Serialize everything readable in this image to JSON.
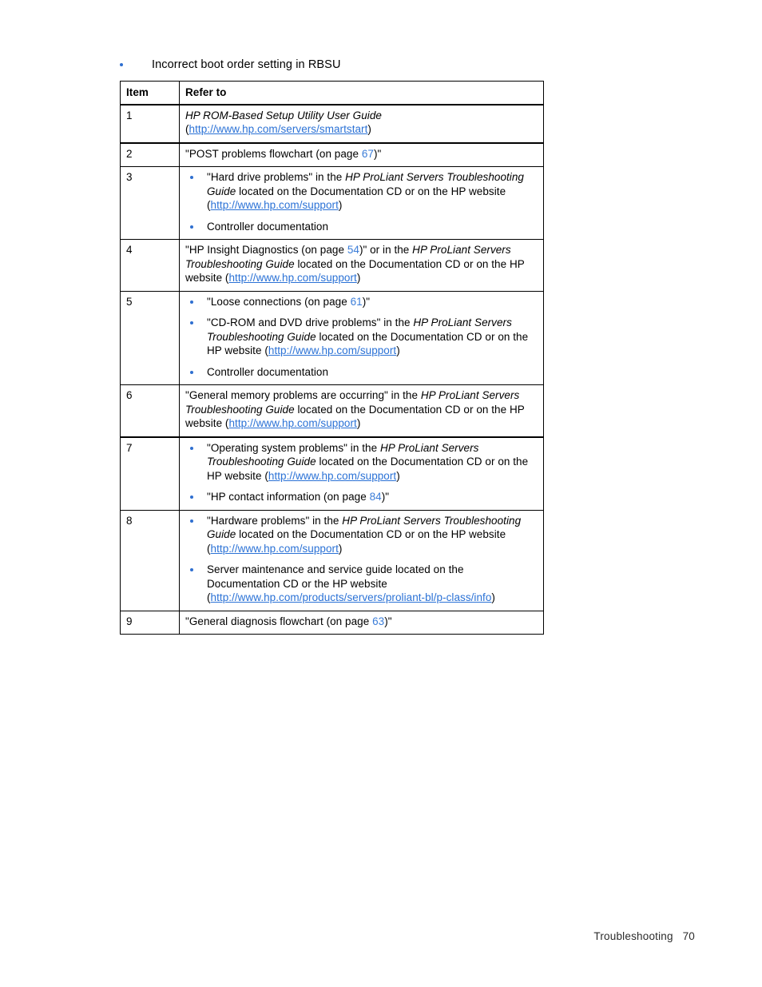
{
  "document": {
    "intro_bullet": "Incorrect boot order setting in RBSU",
    "table": {
      "headers": {
        "item": "Item",
        "refer_to": "Refer to"
      },
      "rows": [
        {
          "item": "1",
          "blocks": [
            {
              "type": "paragraph",
              "segments": [
                {
                  "kind": "italic",
                  "text": "HP ROM-Based Setup Utility User Guide"
                },
                {
                  "kind": "break",
                  "text": ""
                },
                {
                  "kind": "text",
                  "text": "("
                },
                {
                  "kind": "link",
                  "text": "http://www.hp.com/servers/smartstart"
                },
                {
                  "kind": "text",
                  "text": ")"
                }
              ]
            }
          ]
        },
        {
          "item": "2",
          "blocks": [
            {
              "type": "paragraph",
              "segments": [
                {
                  "kind": "text",
                  "text": "\"POST problems flowchart (on page "
                },
                {
                  "kind": "page",
                  "text": "67"
                },
                {
                  "kind": "text",
                  "text": ")\""
                }
              ]
            }
          ]
        },
        {
          "item": "3",
          "blocks": [
            {
              "type": "bullet",
              "segments": [
                {
                  "kind": "text",
                  "text": "\"Hard drive problems\" in the "
                },
                {
                  "kind": "italic",
                  "text": "HP ProLiant Servers Troubleshooting Guide"
                },
                {
                  "kind": "text",
                  "text": " located on the Documentation CD or on the HP website ("
                },
                {
                  "kind": "link",
                  "text": "http://www.hp.com/support"
                },
                {
                  "kind": "text",
                  "text": ")"
                }
              ]
            },
            {
              "type": "bullet",
              "segments": [
                {
                  "kind": "text",
                  "text": "Controller documentation"
                }
              ]
            }
          ]
        },
        {
          "item": "4",
          "blocks": [
            {
              "type": "paragraph",
              "segments": [
                {
                  "kind": "text",
                  "text": "\"HP Insight Diagnostics (on page "
                },
                {
                  "kind": "page",
                  "text": "54"
                },
                {
                  "kind": "text",
                  "text": ")\" or in the "
                },
                {
                  "kind": "italic",
                  "text": "HP ProLiant Servers Troubleshooting Guide"
                },
                {
                  "kind": "text",
                  "text": " located on the Documentation CD or on the HP website ("
                },
                {
                  "kind": "link",
                  "text": "http://www.hp.com/support"
                },
                {
                  "kind": "text",
                  "text": ")"
                }
              ]
            }
          ]
        },
        {
          "item": "5",
          "blocks": [
            {
              "type": "bullet",
              "segments": [
                {
                  "kind": "text",
                  "text": "\"Loose connections (on page "
                },
                {
                  "kind": "page",
                  "text": "61"
                },
                {
                  "kind": "text",
                  "text": ")\""
                }
              ]
            },
            {
              "type": "bullet",
              "segments": [
                {
                  "kind": "text",
                  "text": "\"CD-ROM and DVD drive problems\" in the "
                },
                {
                  "kind": "italic",
                  "text": "HP ProLiant Servers Troubleshooting Guide"
                },
                {
                  "kind": "text",
                  "text": " located on the Documentation CD or on the HP website ("
                },
                {
                  "kind": "link",
                  "text": "http://www.hp.com/support"
                },
                {
                  "kind": "text",
                  "text": ")"
                }
              ]
            },
            {
              "type": "bullet",
              "segments": [
                {
                  "kind": "text",
                  "text": "Controller documentation"
                }
              ]
            }
          ]
        },
        {
          "item": "6",
          "blocks": [
            {
              "type": "paragraph",
              "segments": [
                {
                  "kind": "text",
                  "text": "\"General memory problems are occurring\" in the "
                },
                {
                  "kind": "italic",
                  "text": "HP ProLiant Servers Troubleshooting Guide"
                },
                {
                  "kind": "text",
                  "text": " located on the Documentation CD or on the HP website ("
                },
                {
                  "kind": "link",
                  "text": "http://www.hp.com/support"
                },
                {
                  "kind": "text",
                  "text": ")"
                }
              ]
            }
          ]
        },
        {
          "item": "7",
          "blocks": [
            {
              "type": "bullet",
              "segments": [
                {
                  "kind": "text",
                  "text": "\"Operating system problems\" in the "
                },
                {
                  "kind": "italic",
                  "text": "HP ProLiant Servers Troubleshooting Guide"
                },
                {
                  "kind": "text",
                  "text": " located on the Documentation CD or on the HP website ("
                },
                {
                  "kind": "link",
                  "text": "http://www.hp.com/support"
                },
                {
                  "kind": "text",
                  "text": ")"
                }
              ]
            },
            {
              "type": "bullet",
              "segments": [
                {
                  "kind": "text",
                  "text": "\"HP contact information (on page "
                },
                {
                  "kind": "page",
                  "text": "84"
                },
                {
                  "kind": "text",
                  "text": ")\""
                }
              ]
            }
          ]
        },
        {
          "item": "8",
          "blocks": [
            {
              "type": "bullet",
              "segments": [
                {
                  "kind": "text",
                  "text": "\"Hardware problems\" in the "
                },
                {
                  "kind": "italic",
                  "text": "HP ProLiant Servers Troubleshooting Guide"
                },
                {
                  "kind": "text",
                  "text": " located on the Documentation CD or on the HP website ("
                },
                {
                  "kind": "link",
                  "text": "http://www.hp.com/support"
                },
                {
                  "kind": "text",
                  "text": ")"
                }
              ]
            },
            {
              "type": "bullet",
              "segments": [
                {
                  "kind": "text",
                  "text": "Server maintenance and service guide located on the Documentation CD or the HP website ("
                },
                {
                  "kind": "link",
                  "text": "http://www.hp.com/products/servers/proliant-bl/p-class/info"
                },
                {
                  "kind": "text",
                  "text": ")"
                }
              ]
            }
          ]
        },
        {
          "item": "9",
          "blocks": [
            {
              "type": "paragraph",
              "segments": [
                {
                  "kind": "text",
                  "text": "\"General diagnosis flowchart (on page "
                },
                {
                  "kind": "page",
                  "text": "63"
                },
                {
                  "kind": "text",
                  "text": ")\""
                }
              ]
            }
          ]
        }
      ],
      "thick_border_after_rows": [
        "1",
        "6"
      ]
    }
  },
  "footer": {
    "chapter": "Troubleshooting",
    "page_number": "70",
    "text": "Troubleshooting   70"
  },
  "colors": {
    "link": "#2b72d6",
    "page_ref": "#3b7dd8",
    "bullet": "#2f6fd0",
    "rule": "#000000",
    "text": "#000000",
    "footer_text": "#2b2b2b"
  }
}
